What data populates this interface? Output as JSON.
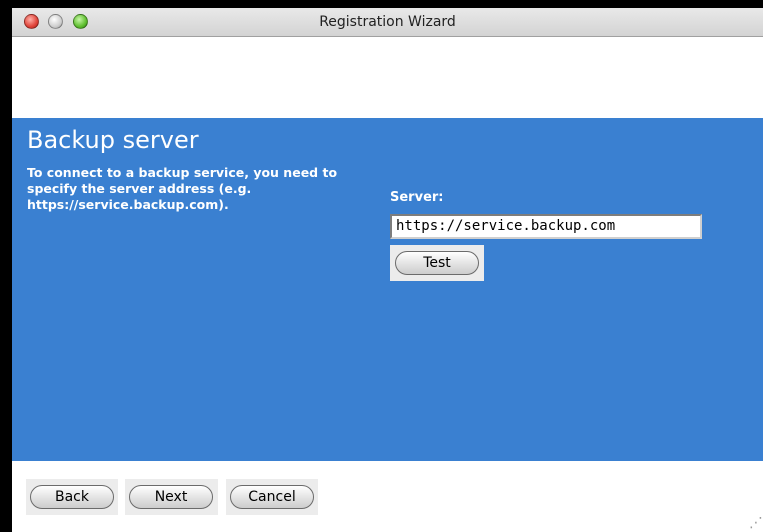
{
  "window": {
    "title": "Registration Wizard"
  },
  "colors": {
    "panel_background": "#3a80d1",
    "panel_text": "#ffffff"
  },
  "panel": {
    "heading": "Backup server",
    "description": "To connect to a backup service, you need to specify the server address (e.g. https://service.backup.com).",
    "server_label": "Server:",
    "server_value": "https://service.backup.com",
    "test_button": "Test"
  },
  "footer": {
    "back_button": "Back",
    "next_button": "Next",
    "cancel_button": "Cancel"
  },
  "icons": {
    "close": "close-icon",
    "minimize": "minimize-icon",
    "zoom": "zoom-icon",
    "resize": "resize-grip-icon"
  }
}
